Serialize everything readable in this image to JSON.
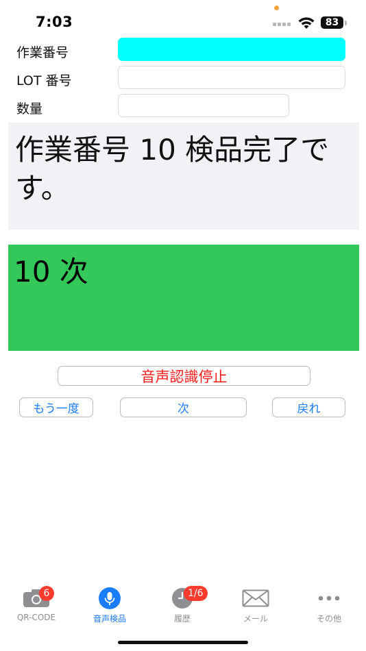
{
  "status_bar": {
    "time": "7:03",
    "battery": "83"
  },
  "form": {
    "work_number_label": "作業番号",
    "lot_number_label": "LOT 番号",
    "quantity_label": "数量",
    "work_number_value": "",
    "lot_number_value": "",
    "quantity_value": "",
    "work_number_field_color": "#00ffff"
  },
  "message": {
    "text": "作業番号 10 検品完了です。"
  },
  "result": {
    "text": "10 次",
    "background_color": "#34c759"
  },
  "buttons": {
    "stop_recognition": "音声認識停止",
    "again": "もう一度",
    "next": "次",
    "back": "戻れ"
  },
  "tab_bar": {
    "tabs": [
      {
        "label": "QR-CODE",
        "icon": "camera-icon",
        "badge": "6",
        "active": false
      },
      {
        "label": "音声検品",
        "icon": "microphone-icon",
        "badge": "",
        "active": true
      },
      {
        "label": "履歴",
        "icon": "clock-icon",
        "badge": "1/6",
        "active": false
      },
      {
        "label": "メール",
        "icon": "mail-icon",
        "badge": "",
        "active": false
      },
      {
        "label": "その他",
        "icon": "more-icon",
        "badge": "",
        "active": false
      }
    ]
  },
  "colors": {
    "accent": "#1a7cff",
    "stop_text": "#ff1a1a",
    "badge": "#ff3b30"
  }
}
